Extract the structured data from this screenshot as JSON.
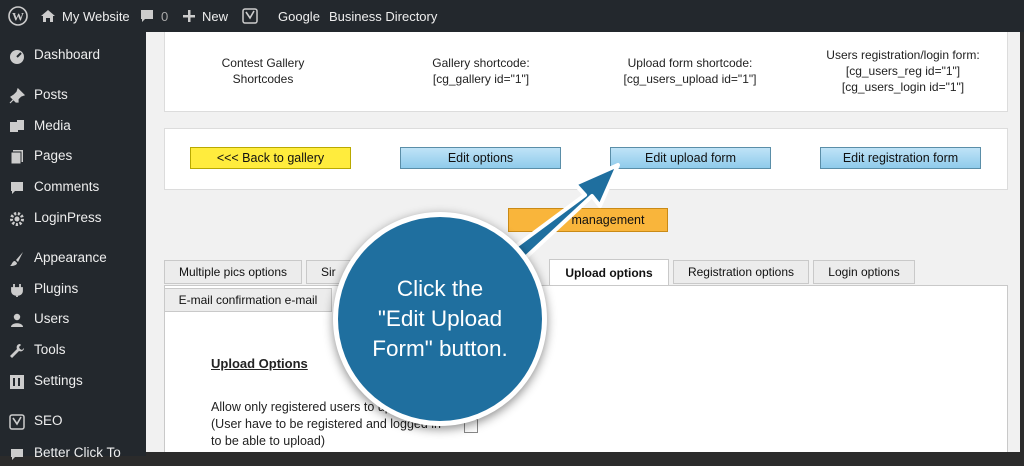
{
  "adminbar": {
    "site_title": "My Website",
    "comments_count": "0",
    "new_label": "New",
    "google_label": "Google",
    "business_label": "Business Directory"
  },
  "sidebar": {
    "items": [
      {
        "label": "Dashboard",
        "icon": "dashboard-icon"
      },
      {
        "label": "Posts",
        "icon": "pin-icon"
      },
      {
        "label": "Media",
        "icon": "media-icon"
      },
      {
        "label": "Pages",
        "icon": "pages-icon"
      },
      {
        "label": "Comments",
        "icon": "comments-icon"
      },
      {
        "label": "LoginPress",
        "icon": "gear-icon"
      },
      {
        "label": "Appearance",
        "icon": "brush-icon"
      },
      {
        "label": "Plugins",
        "icon": "plug-icon"
      },
      {
        "label": "Users",
        "icon": "users-icon"
      },
      {
        "label": "Tools",
        "icon": "wrench-icon"
      },
      {
        "label": "Settings",
        "icon": "settings-icon"
      },
      {
        "label": "SEO",
        "icon": "seo-icon"
      },
      {
        "label": "Better Click To",
        "icon": "click-icon"
      }
    ]
  },
  "shortcodes": {
    "contest_line1": "Contest Gallery",
    "contest_line2": "Shortcodes",
    "gallery_title": "Gallery shortcode:",
    "gallery_code": "[cg_gallery id=\"1\"]",
    "upload_title": "Upload form shortcode:",
    "upload_code": "[cg_users_upload id=\"1\"]",
    "users_title": "Users registration/login form:",
    "users_code1": "[cg_users_reg id=\"1\"]",
    "users_code2": "[cg_users_login id=\"1\"]"
  },
  "buttons": {
    "back": "<<<   Back to gallery",
    "edit_options": "Edit options",
    "edit_upload": "Edit upload form",
    "edit_registration": "Edit registration form",
    "management_visible": "management"
  },
  "tabs": [
    {
      "label": "Multiple pics options"
    },
    {
      "label": "Sir"
    },
    {
      "label": "Upload options"
    },
    {
      "label": "Registration options"
    },
    {
      "label": "Login options"
    },
    {
      "label": "E-mail confirmation e-mail"
    }
  ],
  "upload_section": {
    "title": "Upload Options",
    "line1": "Allow only registered users to uplo",
    "line2": "(User have to be registered and logged in",
    "line3": "to be able to upload)"
  },
  "callout": {
    "line1": "Click the",
    "line2": "\"Edit Upload",
    "line3": "Form\" button."
  },
  "colors": {
    "callout": "#1f6f9f",
    "yellow_button": "#ffec3d",
    "blue_button": "#8fcbeb",
    "orange_button": "#f9b53b"
  }
}
